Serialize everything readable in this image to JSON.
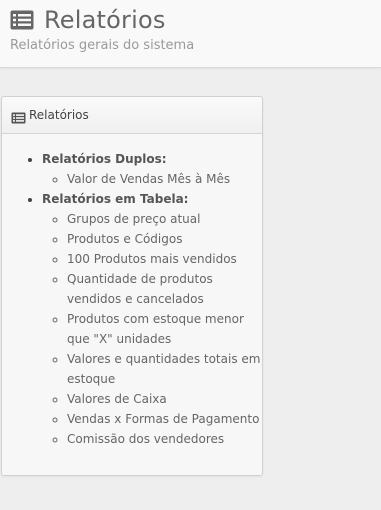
{
  "header": {
    "icon": "list-alt-icon",
    "title": "Relatórios",
    "subtitle": "Relatórios gerais do sistema"
  },
  "panel": {
    "icon": "list-alt-icon",
    "title": "Relatórios",
    "groups": [
      {
        "label": "Relatórios Duplos:",
        "items": [
          "Valor de Vendas Mês à Mês"
        ]
      },
      {
        "label": "Relatórios em Tabela:",
        "items": [
          "Grupos de preço atual",
          "Produtos e Códigos",
          "100 Produtos mais vendidos",
          "Quantidade de produtos vendidos e cancelados",
          "Produtos com estoque menor que \"X\" unidades",
          "Valores e quantidades totais em estoque",
          "Valores de Caixa",
          "Vendas x Formas de Pagamento",
          "Comissão dos vendedores"
        ]
      }
    ]
  }
}
